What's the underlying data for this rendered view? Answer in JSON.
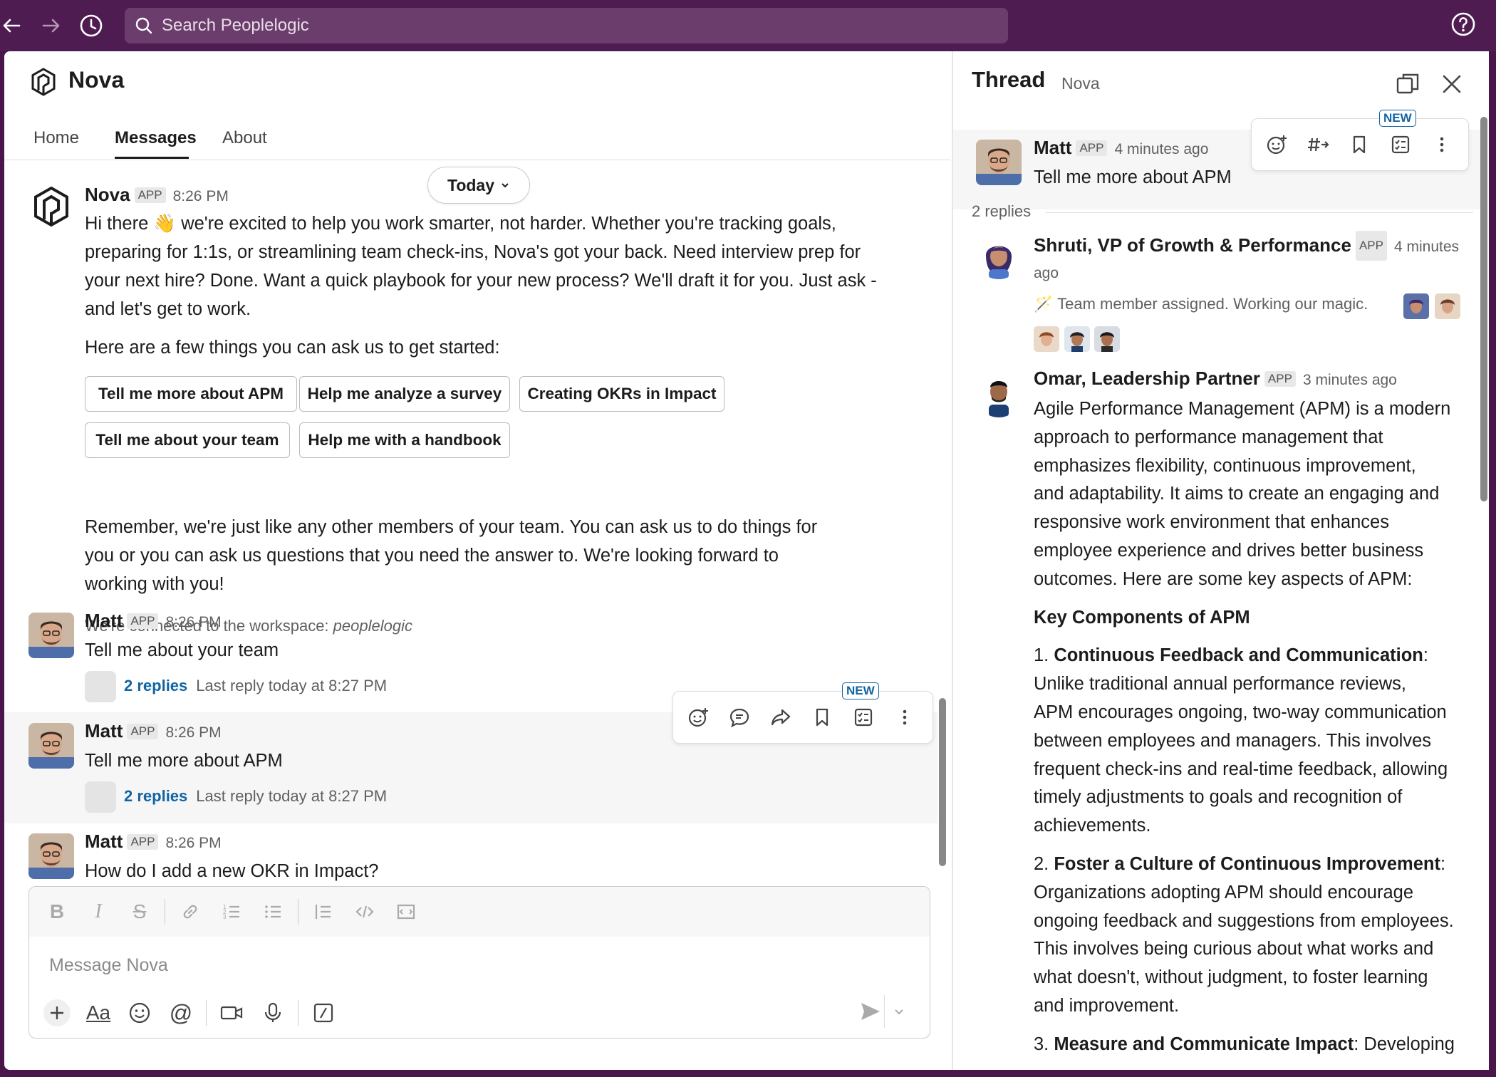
{
  "topbar": {
    "search_placeholder": "Search Peoplelogic"
  },
  "header": {
    "app_name": "Nova",
    "tabs": [
      {
        "label": "Home"
      },
      {
        "label": "Messages"
      },
      {
        "label": "About"
      }
    ],
    "date_pill": "Today"
  },
  "intro": {
    "sender": "Nova",
    "badge": "APP",
    "time": "8:26 PM",
    "lines": [
      "Hi there 👋 we're excited to help you work smarter, not harder. Whether you're tracking goals,",
      "preparing for 1:1s, or streamlining team check-ins, Nova's got your back. Need interview prep for",
      "your next hire? Done. Want a quick playbook for your new process? We'll draft it for you. Just ask -",
      "and let's get to work."
    ],
    "prompt": "Here are a few things you can ask us to get started:",
    "chips": [
      {
        "label": "Tell me more about APM"
      },
      {
        "label": "Help me analyze a survey"
      },
      {
        "label": "Creating OKRs in Impact"
      },
      {
        "label": "Tell me about your team"
      },
      {
        "label": "Help me with a handbook"
      }
    ],
    "closing": [
      "Remember, we're just like any other members of your team.  You can ask us to do things for",
      "you or you can ask us questions that you need the answer to.  We're looking forward to",
      "working with you!"
    ],
    "workspace_prefix": "We're connected to the workspace: ",
    "workspace": "peoplelogic"
  },
  "messages": [
    {
      "sender": "Matt",
      "badge": "APP",
      "time": "8:26 PM",
      "text": "Tell me about your team",
      "replies": "2 replies",
      "last_reply": "Last reply today at 8:27 PM"
    },
    {
      "sender": "Matt",
      "badge": "APP",
      "time": "8:26 PM",
      "text": "Tell me more about APM",
      "replies": "2 replies",
      "last_reply": "Last reply today at 8:27 PM"
    },
    {
      "sender": "Matt",
      "badge": "APP",
      "time": "8:26 PM",
      "text": "How do I add a new OKR in Impact?"
    }
  ],
  "toolbar": {
    "new_badge": "NEW"
  },
  "composer": {
    "placeholder": "Message Nova"
  },
  "thread": {
    "title": "Thread",
    "subtitle": "Nova",
    "root": {
      "sender": "Matt",
      "badge": "APP",
      "time": "4 minutes ago",
      "text": "Tell me more about APM"
    },
    "reply_count": "2 replies",
    "replies": [
      {
        "sender": "Shruti, VP of Growth & Performance",
        "badge": "APP",
        "time": "4 minutes",
        "time2": "ago",
        "status": "🪄 Team member assigned. Working our magic."
      },
      {
        "sender": "Omar, Leadership Partner",
        "badge": "APP",
        "time": "3 minutes ago"
      }
    ],
    "answer": {
      "para1": [
        "Agile Performance Management (APM) is a modern",
        "approach to performance management that",
        "emphasizes flexibility, continuous improvement,",
        "and adaptability. It aims to create an engaging and",
        "responsive work environment that enhances",
        "employee experience and drives better business",
        "outcomes. Here are some key aspects of APM:"
      ],
      "heading": "Key Components of APM",
      "item1_num": "1. ",
      "item1_title": "Continuous Feedback and Communication",
      "item1_lines": [
        "Unlike traditional annual performance reviews,",
        "APM encourages ongoing, two-way communication",
        "between employees and managers. This involves",
        "frequent check-ins and real-time feedback, allowing",
        "timely adjustments to goals and recognition of",
        "achievements."
      ],
      "item2_num": "2. ",
      "item2_title": "Foster a Culture of Continuous Improvement",
      "item2_lines": [
        "Organizations adopting APM should encourage",
        "ongoing feedback and suggestions from employees.",
        "This involves being curious about what works and",
        "what doesn't, without judgment, to foster learning",
        "and improvement."
      ],
      "item3_num": "3. ",
      "item3_title": "Measure and Communicate Impact",
      "item3_rest": ": Developing"
    }
  }
}
